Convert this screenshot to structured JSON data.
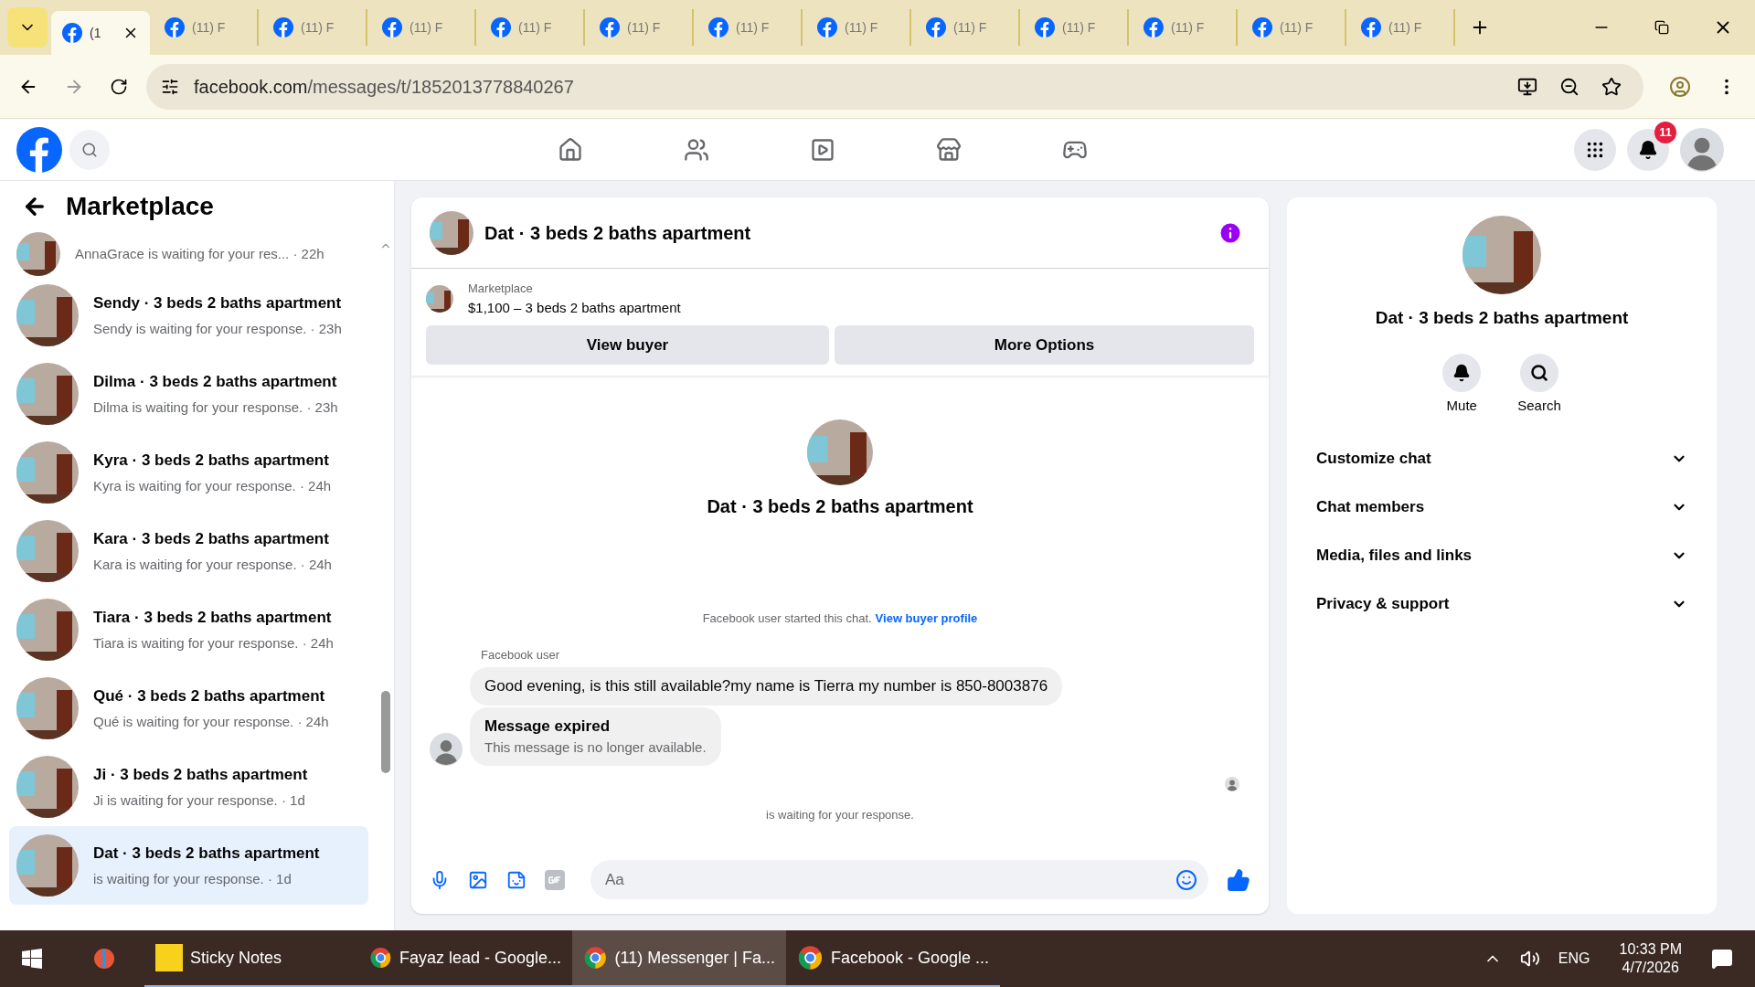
{
  "browser": {
    "tabs": [
      {
        "label": "(1",
        "selected": true
      },
      {
        "label": "(11) F",
        "selected": false
      },
      {
        "label": "(11) F",
        "selected": false
      },
      {
        "label": "(11) F",
        "selected": false
      },
      {
        "label": "(11) F",
        "selected": false
      },
      {
        "label": "(11) F",
        "selected": false
      },
      {
        "label": "(11) F",
        "selected": false
      },
      {
        "label": "(11) F",
        "selected": false
      },
      {
        "label": "(11) F",
        "selected": false
      },
      {
        "label": "(11) F",
        "selected": false
      },
      {
        "label": "(11) F",
        "selected": false
      },
      {
        "label": "(11) F",
        "selected": false
      },
      {
        "label": "(11) F",
        "selected": false
      }
    ],
    "url_host": "facebook.com",
    "url_path": "/messages/t/1852013778840267"
  },
  "header": {
    "notification_count": "11"
  },
  "sidebar": {
    "title": "Marketplace",
    "conversations": [
      {
        "preview": "AnnaGrace is waiting for your res... · 22h",
        "selected": false
      },
      {
        "title": "Sendy · 3 beds 2 baths apartment",
        "preview": "Sendy is waiting for your response. · 23h",
        "selected": false
      },
      {
        "title": "Dilma · 3 beds 2 baths apartment",
        "preview": "Dilma is waiting for your response. · 23h",
        "selected": false
      },
      {
        "title": "Kyra · 3 beds 2 baths apartment",
        "preview": "Kyra is waiting for your response. · 24h",
        "selected": false
      },
      {
        "title": "Kara · 3 beds 2 baths apartment",
        "preview": "Kara is waiting for your response. · 24h",
        "selected": false
      },
      {
        "title": "Tiara · 3 beds 2 baths apartment",
        "preview": "Tiara is waiting for your response. · 24h",
        "selected": false
      },
      {
        "title": "Qué · 3 beds 2 baths apartment",
        "preview": "Qué is waiting for your response. · 24h",
        "selected": false
      },
      {
        "title": "Ji · 3 beds 2 baths apartment",
        "preview": "Ji is waiting for your response. · 1d",
        "selected": false
      },
      {
        "title": "Dat · 3 beds 2 baths apartment",
        "preview": "is waiting for your response. · 1d",
        "selected": true
      }
    ]
  },
  "chat": {
    "title": "Dat · 3 beds 2 baths apartment",
    "listing_label": "Marketplace",
    "listing": "$1,100 – 3 beds 2 baths apartment",
    "buttons": [
      "View buyer",
      "More Options"
    ],
    "intro_name": "Dat · 3 beds 2 baths apartment",
    "started_text": "Facebook user started this chat.",
    "started_link": "View buyer profile",
    "sender": "Facebook user",
    "messages": [
      {
        "kind": "text",
        "text": "Good evening, is this still available?my name is Tierra my number is 850-8003876"
      },
      {
        "kind": "expired",
        "title": "Message expired",
        "text": "This message is no longer available."
      }
    ],
    "waiting": "is waiting for your response.",
    "composer_placeholder": "Aa"
  },
  "details": {
    "name": "Dat · 3 beds 2 baths apartment",
    "actions": [
      {
        "kind": "mute",
        "label": "Mute"
      },
      {
        "kind": "search",
        "label": "Search"
      }
    ],
    "sections": [
      "Customize chat",
      "Chat members",
      "Media, files and links",
      "Privacy & support"
    ]
  },
  "taskbar": {
    "apps": [
      {
        "kind": "notes",
        "label": "Sticky Notes",
        "selected": false
      },
      {
        "kind": "chrome",
        "label": "Fayaz lead - Google...",
        "selected": false
      },
      {
        "kind": "chrome",
        "label": "(11) Messenger | Fa...",
        "selected": true
      },
      {
        "kind": "chrome",
        "label": "Facebook - Google ...",
        "selected": false
      }
    ],
    "language": "ENG",
    "time": "10:33 PM",
    "date": "4/7/2026"
  }
}
